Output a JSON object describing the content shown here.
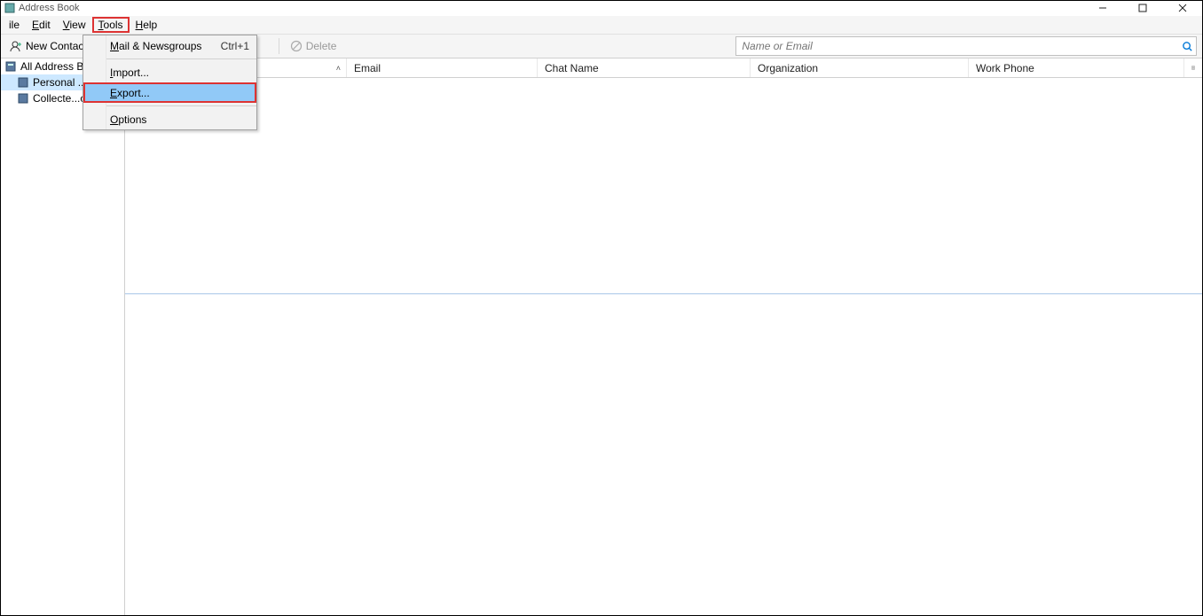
{
  "window": {
    "title": "Address Book"
  },
  "menubar": {
    "items": [
      "ile",
      "Edit",
      "View",
      "Tools",
      "Help"
    ],
    "highlighted_index": 3
  },
  "toolbar": {
    "new_contact": "New Contact",
    "delete": "Delete"
  },
  "search": {
    "placeholder": "Name or Email"
  },
  "sidebar": {
    "root": "All Address B",
    "items": [
      {
        "label": "Personal ..",
        "selected": true
      },
      {
        "label": "Collecte...c",
        "selected": false
      }
    ]
  },
  "columns": {
    "name": "",
    "email": "Email",
    "chat": "Chat Name",
    "org": "Organization",
    "phone": "Work Phone"
  },
  "dropdown": {
    "items": [
      {
        "label": "Mail & Newsgroups",
        "shortcut": "Ctrl+1",
        "underline": "M"
      },
      {
        "sep": true
      },
      {
        "label": "Import...",
        "underline": "I"
      },
      {
        "label": "Export...",
        "underline": "E",
        "highlighted": true
      },
      {
        "sep": true
      },
      {
        "label": "Options",
        "underline": "O"
      }
    ]
  }
}
